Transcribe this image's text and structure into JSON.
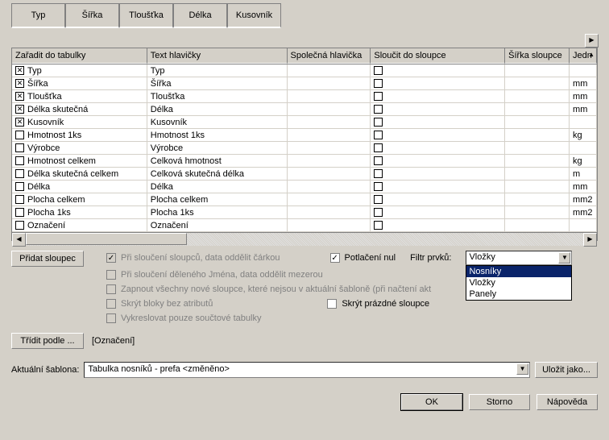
{
  "tabs": [
    "Typ",
    "Šířka",
    "Tloušťka",
    "Délka",
    "Kusovník"
  ],
  "columns": {
    "c0": "Zařadit do tabulky",
    "c1": "Text hlavičky",
    "c2": "Společná hlavička",
    "c3": "Sloučit do sloupce",
    "c4": "Šířka sloupce",
    "c5": "Jedn"
  },
  "rows": [
    {
      "inc": true,
      "name": "Typ",
      "head": "Typ",
      "unit": ""
    },
    {
      "inc": true,
      "name": "Šířka",
      "head": "Šířka",
      "unit": "mm"
    },
    {
      "inc": true,
      "name": "Tloušťka",
      "head": "Tloušťka",
      "unit": "mm"
    },
    {
      "inc": true,
      "name": "Délka skutečná",
      "head": "Délka",
      "unit": "mm"
    },
    {
      "inc": true,
      "name": "Kusovník",
      "head": "Kusovník",
      "unit": ""
    },
    {
      "inc": false,
      "name": "Hmotnost 1ks",
      "head": "Hmotnost 1ks",
      "unit": "kg"
    },
    {
      "inc": false,
      "name": "Výrobce",
      "head": "Výrobce",
      "unit": ""
    },
    {
      "inc": false,
      "name": "Hmotnost celkem",
      "head": "Celková hmotnost",
      "unit": "kg"
    },
    {
      "inc": false,
      "name": "Délka skutečná celkem",
      "head": "Celková skutečná délka",
      "unit": "m"
    },
    {
      "inc": false,
      "name": "Délka",
      "head": "Délka",
      "unit": "mm"
    },
    {
      "inc": false,
      "name": "Plocha celkem",
      "head": "Plocha celkem",
      "unit": "mm2"
    },
    {
      "inc": false,
      "name": "Plocha 1ks",
      "head": "Plocha 1ks",
      "unit": "mm2"
    },
    {
      "inc": false,
      "name": "Označení",
      "head": "Označení",
      "unit": ""
    }
  ],
  "opts": {
    "merge_comma": "Při sloučení sloupců, data oddělit čárkou",
    "suppress_null": "Potlačení nul",
    "filter_label": "Filtr prvků:",
    "merge_space": "Při sloučení děleného Jména, data oddělit mezerou",
    "include_new": "Zapnout všechny nové sloupce, které nejsou v aktuální šabloně (při načtení akt",
    "hide_attr": "Skrýt bloky bez atributů",
    "hide_empty": "Skrýt prázdné sloupce",
    "draw_sum": "Vykreslovat pouze součtové tabulky"
  },
  "dropdown": {
    "value": "Vložky",
    "items": [
      "Nosníky",
      "Vložky",
      "Panely"
    ]
  },
  "add_col": "Přidat sloupec",
  "sort_btn": "Třídit podle ...",
  "sort_val": "[Označení]",
  "tpl_label": "Aktuální šablona:",
  "tpl_value": "Tabulka nosníků - prefa <změněno>",
  "save_as": "Uložit jako...",
  "ok": "OK",
  "cancel": "Storno",
  "help": "Nápověda"
}
